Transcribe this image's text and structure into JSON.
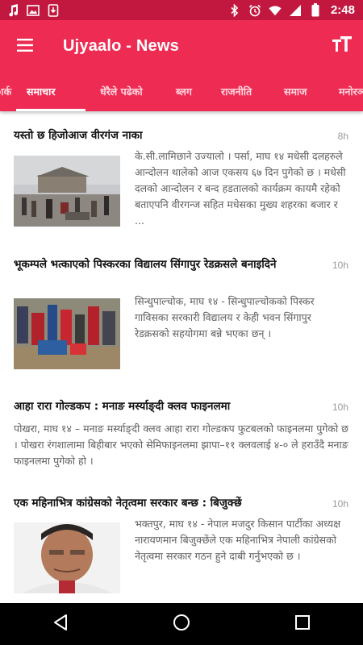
{
  "status_bar": {
    "time": "2:48",
    "left_icons": [
      "music-icon",
      "image-icon",
      "download-icon"
    ],
    "right_icons": [
      "bluetooth-icon",
      "alarm-icon",
      "wifi-icon",
      "signal-icon",
      "battery-icon"
    ]
  },
  "app": {
    "title": "Ujyaalo - News",
    "menu_icon": "hamburger-menu-icon",
    "font_icon": "text-size-icon"
  },
  "tabs": [
    {
      "label": "ार्क",
      "active": false
    },
    {
      "label": "समाचार",
      "active": true
    },
    {
      "label": "धेरैले पढेको",
      "active": false
    },
    {
      "label": "ब्लग",
      "active": false
    },
    {
      "label": "राजनीति",
      "active": false
    },
    {
      "label": "समाज",
      "active": false
    },
    {
      "label": "मनोरञ्जन",
      "active": false
    }
  ],
  "articles": [
    {
      "title": "यस्तो छ हिजोआज वीरगंज नाका",
      "time": "8h",
      "summary": "के.सी.लामिछाने उज्यालो । पर्सा, माघ १४ मधेसी दलहरुले आन्दोलन थालेको आज एकसय ६७ दिन पुगेको छ । मधेसी दलको आन्दोलन र बन्द हडतालको कार्यक्रम कायमै रहेको बताएपनि वीरगन्ज सहित मधेसका मुख्य शहरका बजार र ...",
      "image": "border-crossing-photo"
    },
    {
      "title": "भूकम्पले भत्काएको पिस्करका विद्यालय सिंगापुर रेडक्रसले बनाइदिने",
      "time": "10h",
      "summary": "सिन्धुपाल्चोक, माघ १४ - सिन्धुपाल्चोकको पिस्कर गाविसका सरकारी विद्यालय र केही भवन सिंगापुर रेडक्रसको सहयोगमा बन्ने भएका छन् ।",
      "image": "red-cross-volunteers-photo"
    },
    {
      "title": "आहा रारा गोल्डकप : मनाङ मर्स्याङ्दी क्लव फाइनलमा",
      "time": "10h",
      "summary": "पोखरा, माघ १४ – मनाङ मर्स्याङ्दी क्लव आहा रारा गोल्डकप फुटबलको फाइनलमा पुगेको छ । पोखरा रंगशालामा बिहीबार भएको सेमिफाइनलमा झापा–११ क्लवलाई ४-० ले हराउँदै मनाङ फाइनलमा पुगेको हो ।",
      "image": null
    },
    {
      "title": "एक महिनाभित्र कांग्रेसको नेतृत्वमा सरकार बन्छ : बिजुक्छें",
      "time": "10h",
      "summary": "भक्तपुर, माघ १४ - नेपाल मजदुर किसान पार्टीका अध्यक्ष नारायणमान बिजुक्छेंले एक महिनाभित्र नेपाली कांग्रेसको नेतृत्वमा सरकार गठन हुने दाबी गर्नुभएको छ ।",
      "image": "politician-portrait-photo"
    }
  ],
  "nav_bar": {
    "buttons": [
      "back-icon",
      "home-icon",
      "recents-icon"
    ]
  },
  "colors": {
    "status_bar": "#c2183f",
    "app_bar": "#ee2c53",
    "nav_bar": "#000000"
  }
}
